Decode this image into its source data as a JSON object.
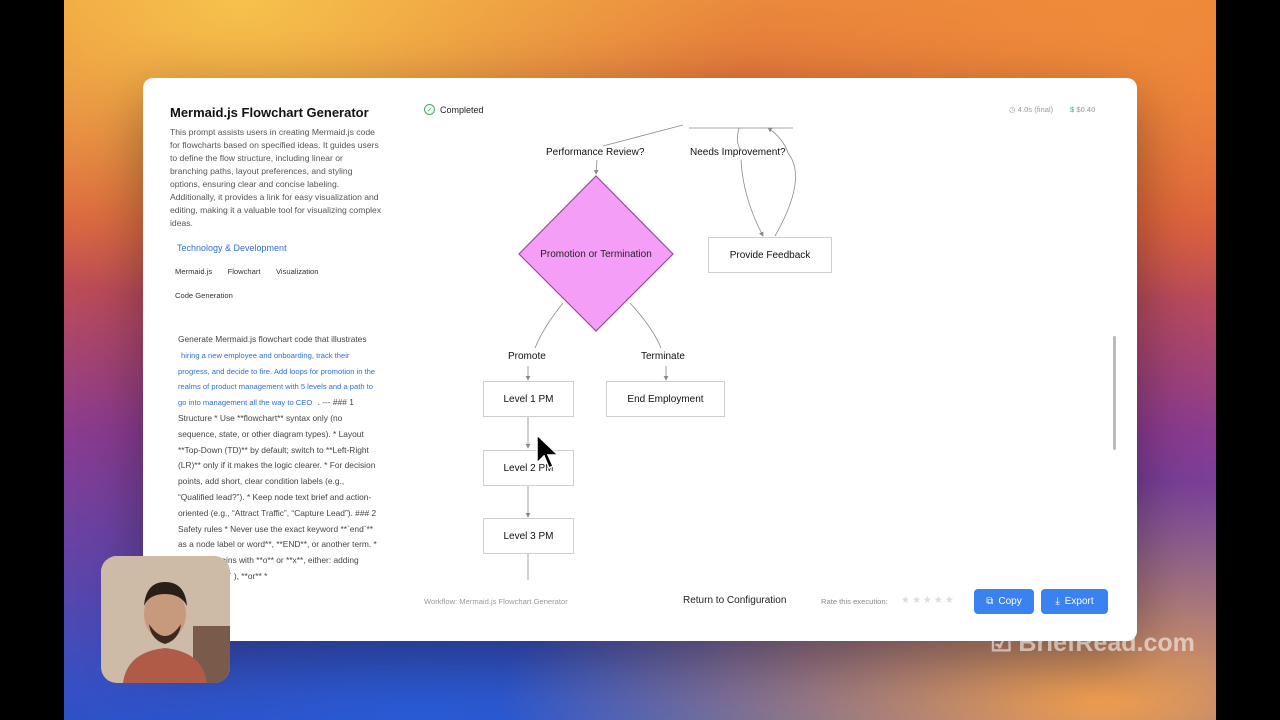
{
  "sidebar": {
    "title": "Mermaid.js Flowchart Generator",
    "description": "This prompt assists users in creating Mermaid.js code for flowcharts based on specified ideas. It guides users to define the flow structure, including linear or branching paths, layout preferences, and styling options, ensuring clear and concise labeling. Additionally, it provides a link for easy visualization and editing, making it a valuable tool for visualizing complex ideas.",
    "category": "Technology & Development",
    "tags": [
      "Mermaid.js",
      "Flowchart",
      "Visualization",
      "Code Generation"
    ],
    "prompt_start": "Generate Mermaid.js flowchart code that illustrates",
    "prompt_highlight": "hiring a new employee and onboarding, track their progress, and decide to fire. Add loops for promotion in the realms of product management with 5 levels and a path to go into management all the way to CEO",
    "prompt_rest": ". --- ### 1 Structure * Use **flowchart** syntax only (no sequence, state, or other diagram types). * Layout **Top-Down (TD)** by default; switch to **Left-Right (LR)** only if it makes the logic clearer. * For decision points, add short, clear condition labels (e.g., “Qualified lead?”). * Keep node text brief and action-oriented (e.g., “Attract Traffic”, “Capture Lead”). ### 2 Safety rules * Never use the exact keyword **`end`** as a node label or word**, **END**, or another term. * If a label begins with **o** or **x**, either: adding space (` oKPI` ), **or** *"
  },
  "status": {
    "label": "Completed",
    "time": "4.0s (final)",
    "cost": "$0.40"
  },
  "flowchart": {
    "nodes": {
      "decision": "Promotion or Termination",
      "provide_feedback": "Provide Feedback",
      "level1": "Level 1 PM",
      "level2": "Level 2 PM",
      "level3": "Level 3 PM",
      "end_employment": "End Employment"
    },
    "edge_labels": {
      "performance_review": "Performance Review?",
      "needs_improvement": "Needs Improvement?",
      "promote": "Promote",
      "terminate": "Terminate"
    },
    "colors": {
      "decision_fill": "#f49ef8",
      "decision_stroke": "#9a4aa0",
      "edge": "#8a8a8a"
    }
  },
  "footer": {
    "workflow": "Workflow: Mermaid.js Flowchart Generator",
    "return_label": "Return to Configuration",
    "rate_label": "Rate this execution:",
    "stars": "★★★★★",
    "copy_label": "Copy",
    "export_label": "Export"
  },
  "watermark": "BriefRead.com"
}
